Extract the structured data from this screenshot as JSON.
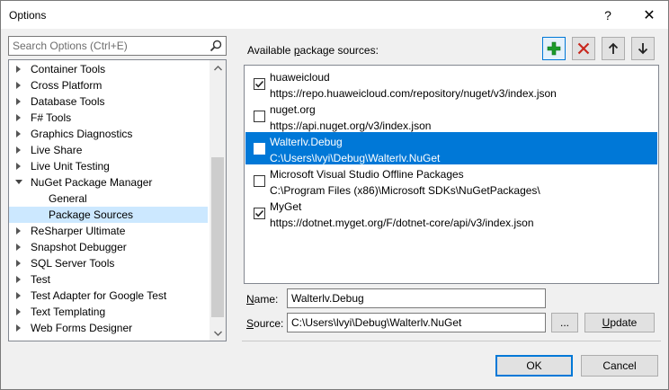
{
  "window": {
    "title": "Options",
    "help_glyph": "?",
    "close_glyph": "✕"
  },
  "search": {
    "placeholder": "Search Options (Ctrl+E)",
    "icon": "search-icon"
  },
  "tree": {
    "items": [
      {
        "label": "Container Tools",
        "level": 0,
        "expanded": false,
        "selected": false
      },
      {
        "label": "Cross Platform",
        "level": 0,
        "expanded": false,
        "selected": false
      },
      {
        "label": "Database Tools",
        "level": 0,
        "expanded": false,
        "selected": false
      },
      {
        "label": "F# Tools",
        "level": 0,
        "expanded": false,
        "selected": false
      },
      {
        "label": "Graphics Diagnostics",
        "level": 0,
        "expanded": false,
        "selected": false
      },
      {
        "label": "Live Share",
        "level": 0,
        "expanded": false,
        "selected": false
      },
      {
        "label": "Live Unit Testing",
        "level": 0,
        "expanded": false,
        "selected": false
      },
      {
        "label": "NuGet Package Manager",
        "level": 0,
        "expanded": true,
        "selected": false
      },
      {
        "label": "General",
        "level": 1,
        "expanded": false,
        "selected": false
      },
      {
        "label": "Package Sources",
        "level": 1,
        "expanded": false,
        "selected": true
      },
      {
        "label": "ReSharper Ultimate",
        "level": 0,
        "expanded": false,
        "selected": false
      },
      {
        "label": "Snapshot Debugger",
        "level": 0,
        "expanded": false,
        "selected": false
      },
      {
        "label": "SQL Server Tools",
        "level": 0,
        "expanded": false,
        "selected": false
      },
      {
        "label": "Test",
        "level": 0,
        "expanded": false,
        "selected": false
      },
      {
        "label": "Test Adapter for Google Test",
        "level": 0,
        "expanded": false,
        "selected": false
      },
      {
        "label": "Text Templating",
        "level": 0,
        "expanded": false,
        "selected": false
      },
      {
        "label": "Web Forms Designer",
        "level": 0,
        "expanded": false,
        "selected": false
      }
    ]
  },
  "sources_panel": {
    "label_before": "Available ",
    "label_access": "p",
    "label_after": "ackage sources:",
    "toolbar": {
      "add_icon": "plus-icon",
      "remove_icon": "x-icon",
      "up_icon": "arrow-up-icon",
      "down_icon": "arrow-down-icon"
    },
    "sources": [
      {
        "name": "huaweicloud",
        "url": "https://repo.huaweicloud.com/repository/nuget/v3/index.json",
        "checked": true,
        "selected": false
      },
      {
        "name": "nuget.org",
        "url": "https://api.nuget.org/v3/index.json",
        "checked": false,
        "selected": false
      },
      {
        "name": "Walterlv.Debug",
        "url": "C:\\Users\\lvyi\\Debug\\Walterlv.NuGet",
        "checked": false,
        "selected": true
      },
      {
        "name": "Microsoft Visual Studio Offline Packages",
        "url": "C:\\Program Files (x86)\\Microsoft SDKs\\NuGetPackages\\",
        "checked": false,
        "selected": false
      },
      {
        "name": "MyGet",
        "url": "https://dotnet.myget.org/F/dotnet-core/api/v3/index.json",
        "checked": true,
        "selected": false
      }
    ]
  },
  "form": {
    "name_label_access": "N",
    "name_label_rest": "ame:",
    "name_value": "Walterlv.Debug",
    "source_label_access": "S",
    "source_label_rest": "ource:",
    "source_value": "C:\\Users\\lvyi\\Debug\\Walterlv.NuGet",
    "browse_label": "...",
    "update_label_access": "U",
    "update_label_rest": "pdate"
  },
  "footer": {
    "ok_label": "OK",
    "cancel_label": "Cancel"
  },
  "colors": {
    "selection": "#0078d7",
    "tree_selection": "#cce8ff",
    "add_green": "#1a9a2a",
    "remove_red": "#c8281e"
  }
}
